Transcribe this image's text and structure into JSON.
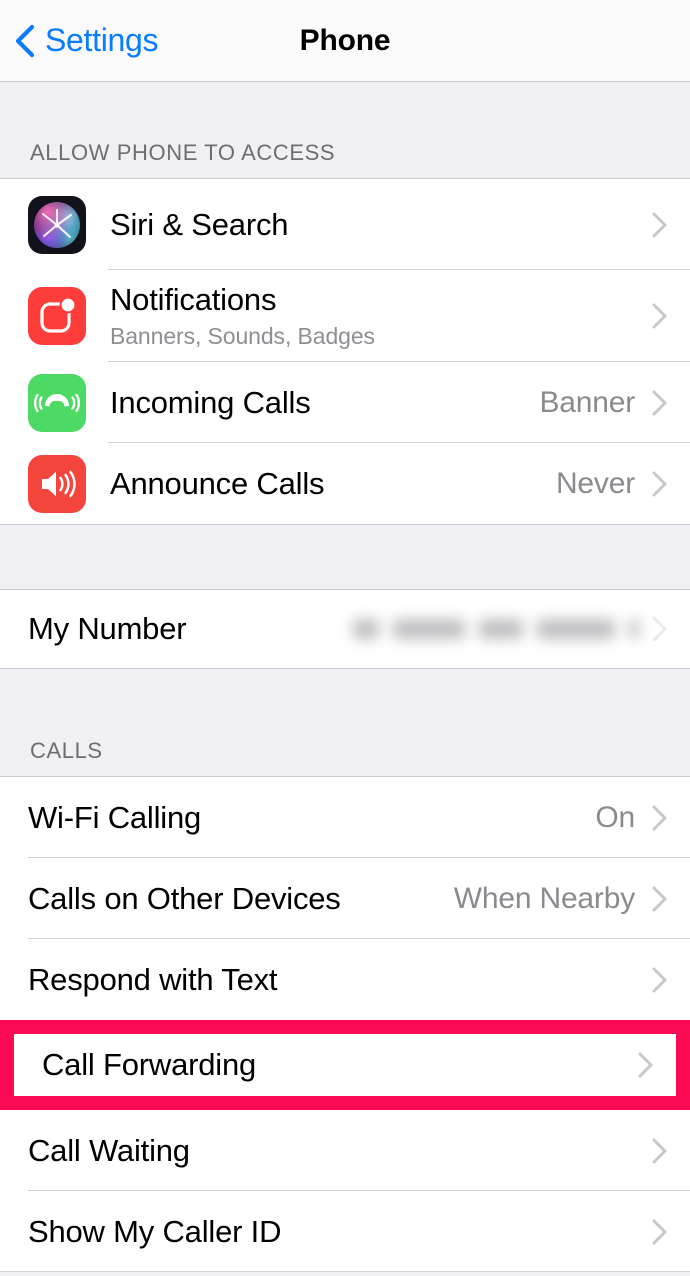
{
  "navbar": {
    "back_label": "Settings",
    "title": "Phone",
    "back_icon": "chevron-left-icon",
    "accent_color": "#0A7CFF"
  },
  "sections": [
    {
      "header": "ALLOW PHONE TO ACCESS",
      "rows": [
        {
          "title": "Siri & Search",
          "subtitle": "",
          "value": "",
          "icon": "siri-icon",
          "icon_color": "#12121C"
        },
        {
          "title": "Notifications",
          "subtitle": "Banners, Sounds, Badges",
          "value": "",
          "icon": "notifications-icon",
          "icon_color": "#FC3D39"
        },
        {
          "title": "Incoming Calls",
          "subtitle": "",
          "value": "Banner",
          "icon": "incoming-call-icon",
          "icon_color": "#4CD964"
        },
        {
          "title": "Announce Calls",
          "subtitle": "",
          "value": "Never",
          "icon": "announce-calls-icon",
          "icon_color": "#F4453C"
        }
      ]
    },
    {
      "header": "",
      "rows": [
        {
          "title": "My Number",
          "subtitle": "",
          "value": "",
          "value_redacted": true,
          "icon": "",
          "icon_color": ""
        }
      ]
    },
    {
      "header": "CALLS",
      "rows": [
        {
          "title": "Wi-Fi Calling",
          "subtitle": "",
          "value": "On",
          "icon": "",
          "icon_color": ""
        },
        {
          "title": "Calls on Other Devices",
          "subtitle": "",
          "value": "When Nearby",
          "icon": "",
          "icon_color": ""
        },
        {
          "title": "Respond with Text",
          "subtitle": "",
          "value": "",
          "icon": "",
          "icon_color": ""
        },
        {
          "title": "Call Forwarding",
          "subtitle": "",
          "value": "",
          "icon": "",
          "icon_color": "",
          "highlighted": true
        },
        {
          "title": "Call Waiting",
          "subtitle": "",
          "value": "",
          "icon": "",
          "icon_color": ""
        },
        {
          "title": "Show My Caller ID",
          "subtitle": "",
          "value": "",
          "icon": "",
          "icon_color": ""
        }
      ]
    }
  ],
  "highlight": {
    "target": "Call Forwarding",
    "color": "#FA0A52"
  },
  "colors": {
    "group_background": "#FFFFFF",
    "page_background": "#EFEFF4",
    "separator": "#D3D3D6",
    "secondary_text": "#8A8A8F",
    "header_text": "#6D6D72"
  },
  "chevron_icon": "chevron-right-icon"
}
